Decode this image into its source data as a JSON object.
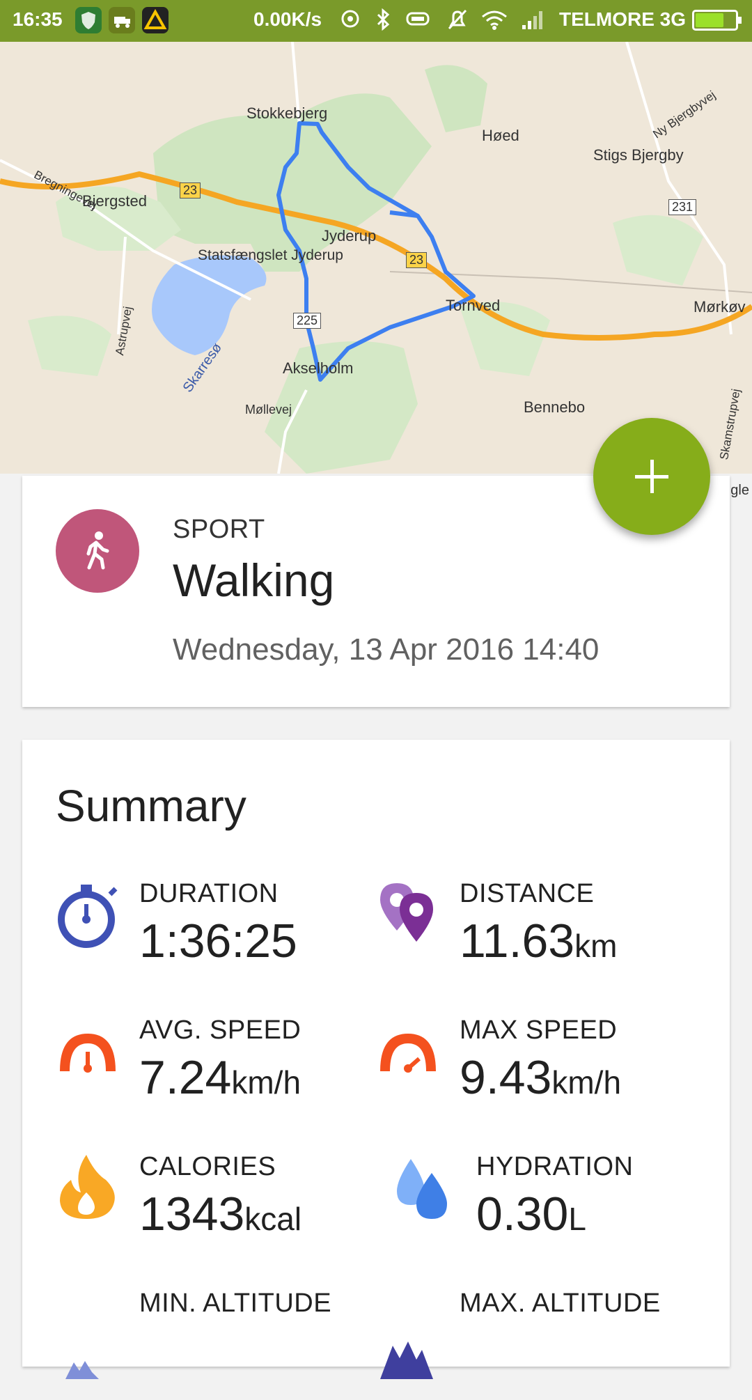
{
  "status_bar": {
    "time": "16:35",
    "network_speed": "0.00K/s",
    "carrier": "TELMORE 3G",
    "app_icons": [
      "shield-app-icon",
      "truck-app-icon",
      "warning-app-icon"
    ],
    "system_icons": [
      "hotspot-icon",
      "bluetooth-icon",
      "vibrate-icon",
      "mute-icon",
      "wifi-icon",
      "signal-icon",
      "battery-icon"
    ]
  },
  "map": {
    "labels": {
      "stokkebjerg": "Stokkebjerg",
      "hoed": "Høed",
      "stigs_bjergby": "Stigs Bjergby",
      "ny_bjergbyvej": "Ny Bjergbyvej",
      "bregningevej": "Bregningevej",
      "bjergsted": "Bjergsted",
      "jyderup": "Jyderup",
      "statsfaengslet": "Statsfængslet Jyderup",
      "astrupvej": "Astrupvej",
      "skarreso": "Skarresø",
      "tornved": "Tornved",
      "morkov": "Mørkøv",
      "akselholm": "Akselholm",
      "mollevej": "Møllevej",
      "bennebo": "Bennebo",
      "skamstrupvej": "Skamstrupvej",
      "road_23a": "23",
      "road_23b": "23",
      "road_231": "231",
      "road_225": "225",
      "google_attr": "gle",
      "google_g": "G"
    },
    "route_color": "#3d7ff0",
    "highway_color": "#f5a623"
  },
  "fab": {
    "icon": "plus-icon"
  },
  "sport_card": {
    "label": "SPORT",
    "value": "Walking",
    "date": "Wednesday, 13 Apr 2016 14:40",
    "icon": "walking-icon",
    "icon_color": "#c0567a"
  },
  "summary": {
    "title": "Summary",
    "stats": {
      "duration": {
        "label": "DURATION",
        "value": "1:36:25",
        "unit": "",
        "icon": "stopwatch-icon",
        "color": "#3f51b5"
      },
      "distance": {
        "label": "DISTANCE",
        "value": "11.63",
        "unit": "km",
        "icon": "map-pins-icon",
        "color": "#8e3fa6"
      },
      "avg_speed": {
        "label": "AVG. SPEED",
        "value": "7.24",
        "unit": "km/h",
        "icon": "speedometer-icon",
        "color": "#f4511e"
      },
      "max_speed": {
        "label": "MAX SPEED",
        "value": "9.43",
        "unit": "km/h",
        "icon": "speedometer-icon",
        "color": "#f4511e"
      },
      "calories": {
        "label": "CALORIES",
        "value": "1343",
        "unit": "kcal",
        "icon": "flame-icon",
        "color": "#f9a825"
      },
      "hydration": {
        "label": "HYDRATION",
        "value": "0.30",
        "unit": "L",
        "icon": "water-drops-icon",
        "color": "#4f8ef7"
      },
      "min_altitude": {
        "label": "MIN. ALTITUDE",
        "icon": "low-mountain-icon"
      },
      "max_altitude": {
        "label": "MAX. ALTITUDE",
        "icon": "mountain-icon"
      }
    }
  }
}
